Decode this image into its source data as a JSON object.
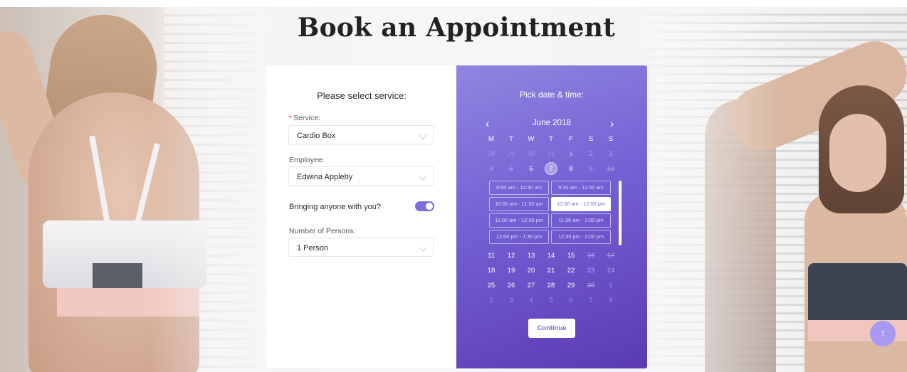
{
  "page": {
    "title": "Book an Appointment"
  },
  "form": {
    "heading": "Please select service:",
    "service": {
      "required_mark": "*",
      "label": "Service:",
      "value": "Cardio Box"
    },
    "employee": {
      "label": "Employee:",
      "value": "Edwina Appleby"
    },
    "bringing": {
      "label": "Bringing anyone with you?",
      "enabled": true
    },
    "persons": {
      "label": "Number of Persons:",
      "value": "1 Person"
    }
  },
  "calendar": {
    "heading": "Pick date & time:",
    "prev_icon": "chevron-left-icon",
    "next_icon": "chevron-right-icon",
    "month": "June 2018",
    "prev_glyph": "‹",
    "next_glyph": "›",
    "weekdays": [
      "M",
      "T",
      "W",
      "T",
      "F",
      "S",
      "S"
    ],
    "week1": [
      "28",
      "29",
      "30",
      "31",
      "1",
      "2",
      "3"
    ],
    "week2": [
      "4",
      "5",
      "6",
      "7",
      "8",
      "9",
      "10"
    ],
    "week3": [
      "11",
      "12",
      "13",
      "14",
      "15",
      "16",
      "17"
    ],
    "week4": [
      "18",
      "19",
      "20",
      "21",
      "22",
      "23",
      "24"
    ],
    "week5": [
      "25",
      "26",
      "27",
      "28",
      "29",
      "30",
      "1"
    ],
    "week6": [
      "2",
      "3",
      "4",
      "5",
      "6",
      "7",
      "8"
    ],
    "selected_day": "7",
    "time_slots": [
      "9:00 am - 10:30 am",
      "9:30 am - 11:00 am",
      "10:00 am - 11:30 am",
      "10:30 am - 12:00 pm",
      "11:00 am - 12:30 pm",
      "11:30 am - 1:00 pm",
      "12:00 pm - 1:30 pm",
      "12:30 pm - 2:00 pm"
    ],
    "selected_slot": "10:30 am - 12:00 pm",
    "continue_label": "Continue"
  },
  "fab": {
    "glyph": "↑",
    "icon": "arrow-up-icon"
  },
  "colors": {
    "accent": "#7c6ddb",
    "panel_top": "#8f86e0",
    "panel_bottom": "#5b3ab3"
  }
}
